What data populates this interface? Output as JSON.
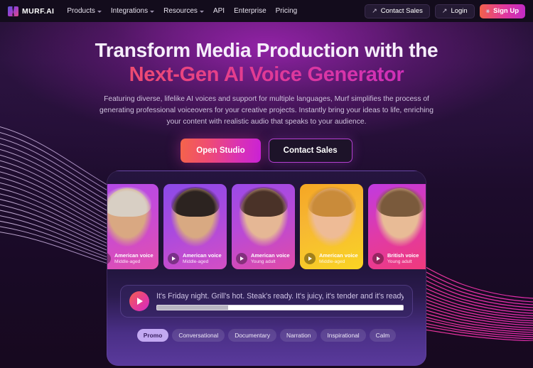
{
  "navbar": {
    "logo_text": "MURF.AI",
    "links": [
      {
        "label": "Products",
        "has_dropdown": true
      },
      {
        "label": "Integrations",
        "has_dropdown": true
      },
      {
        "label": "Resources",
        "has_dropdown": true
      },
      {
        "label": "API",
        "has_dropdown": false
      },
      {
        "label": "Enterprise",
        "has_dropdown": false
      },
      {
        "label": "Pricing",
        "has_dropdown": false
      }
    ],
    "contact_sales_label": "Contact Sales",
    "login_label": "Login",
    "signup_label": "Sign Up",
    "arrow_icon": "↗",
    "user_icon": "⚹"
  },
  "hero": {
    "headline_line1": "Transform Media Production with the",
    "headline_line2": "Next-Gen AI Voice Generator",
    "subtitle": "Featuring diverse, lifelike AI voices and support for multiple languages, Murf simplifies the process of generating professional voiceovers for your creative projects. Instantly bring your ideas to life, enriching your content with realistic audio that speaks to your audience.",
    "primary_cta": "Open Studio",
    "secondary_cta": "Contact Sales"
  },
  "voice_cards": [
    {
      "title": "American voice",
      "subtitle": "Middle-aged",
      "gradient": "linear-gradient(160deg,#b14ae8 0%,#c44ad9 40%,#e24fae 100%)",
      "hair": "#d8cfc4",
      "skin": "#d9a882"
    },
    {
      "title": "American voice",
      "subtitle": "Middle-aged",
      "gradient": "linear-gradient(160deg,#8b4ae8 0%,#a84ae0 45%,#d44ec4 100%)",
      "hair": "#2c2320",
      "skin": "#d8a982"
    },
    {
      "title": "American voice",
      "subtitle": "Young adult",
      "gradient": "linear-gradient(160deg,#9a4ae8 0%,#b84ad8 45%,#e04aa8 100%)",
      "hair": "#4a3228",
      "skin": "#e5b795"
    },
    {
      "title": "American voice",
      "subtitle": "Middle-aged",
      "gradient": "linear-gradient(160deg,#f5a623 0%,#f7b733 40%,#f9d423 100%)",
      "hair": "#c98b3a",
      "skin": "#eebb96"
    },
    {
      "title": "British voice",
      "subtitle": "Young adult",
      "gradient": "linear-gradient(160deg,#c03ae0 0%,#e03aa8 50%,#f03a7a 100%)",
      "hair": "#7a5a3c",
      "skin": "#e8bb96"
    }
  ],
  "player": {
    "script_text": "It's Friday night. Grill's hot. Steak's ready. It's juicy, it's tender and it's ready to be devoured.",
    "progress_percent": 29,
    "play_icon": "play-icon"
  },
  "categories": [
    {
      "label": "Promo",
      "active": true
    },
    {
      "label": "Conversational",
      "active": false
    },
    {
      "label": "Documentary",
      "active": false
    },
    {
      "label": "Narration",
      "active": false
    },
    {
      "label": "Inspirational",
      "active": false
    },
    {
      "label": "Calm",
      "active": false
    }
  ]
}
